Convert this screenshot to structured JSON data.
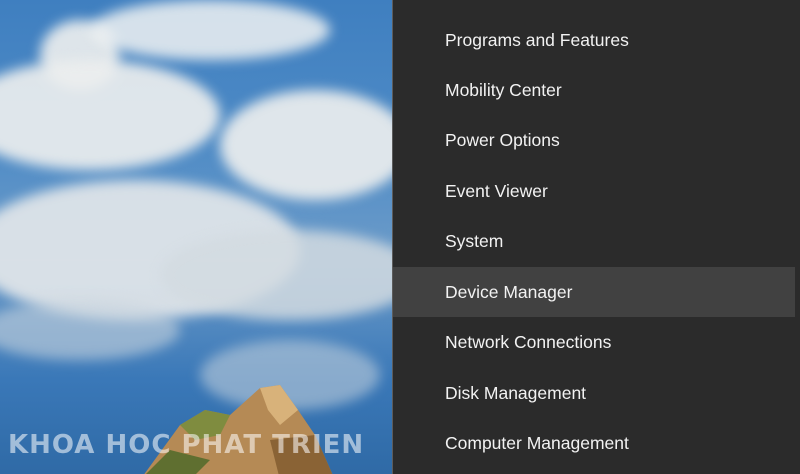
{
  "menu": {
    "items": [
      {
        "label": "Programs and Features"
      },
      {
        "label": "Mobility Center"
      },
      {
        "label": "Power Options"
      },
      {
        "label": "Event Viewer"
      },
      {
        "label": "System"
      },
      {
        "label": "Device Manager",
        "selected": true
      },
      {
        "label": "Network Connections"
      },
      {
        "label": "Disk Management"
      },
      {
        "label": "Computer Management"
      }
    ],
    "colors": {
      "background": "#2b2b2b",
      "highlight": "#414141",
      "text": "#f2f2f2"
    }
  },
  "watermark": {
    "text": "KHOA HOC PHAT TRIEN"
  }
}
